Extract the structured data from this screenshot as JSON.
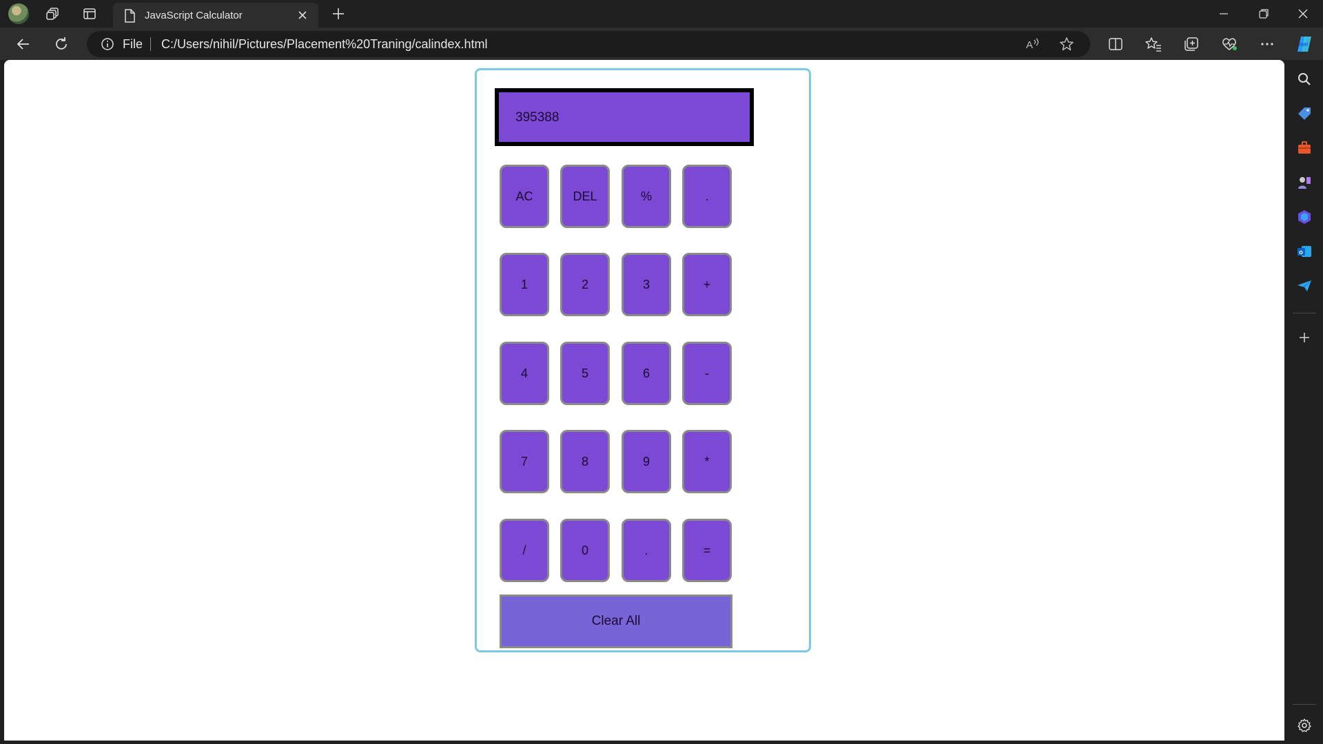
{
  "browser": {
    "tab_title": "JavaScript Calculator",
    "address": {
      "scheme_label": "File",
      "url": "C:/Users/nihil/Pictures/Placement%20Traning/calindex.html"
    }
  },
  "calculator": {
    "display_value": "395388",
    "keys": [
      [
        "AC",
        "DEL",
        "%",
        "."
      ],
      [
        "1",
        "2",
        "3",
        "+"
      ],
      [
        "4",
        "5",
        "6",
        "-"
      ],
      [
        "7",
        "8",
        "9",
        "*"
      ],
      [
        "/",
        "0",
        ".",
        "="
      ]
    ],
    "clear_all_label": "Clear All"
  },
  "colors": {
    "key_bg": "#7b49d4",
    "clear_bg": "#7764d6",
    "frame_border": "#7ec8e3"
  }
}
